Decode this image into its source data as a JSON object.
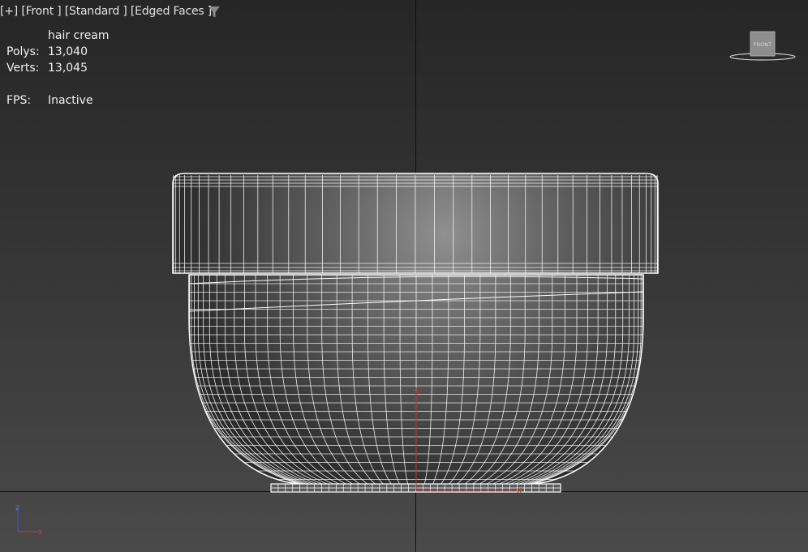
{
  "viewport": {
    "label_plus": "[+]",
    "label_view": "[Front ]",
    "label_shading": "[Standard ]",
    "label_edged": "[Edged Faces ]"
  },
  "stats": {
    "object_name": "hair cream",
    "polys_label": "Polys:",
    "polys_value": "13,040",
    "verts_label": "Verts:",
    "verts_value": "13,045",
    "fps_label": "FPS:",
    "fps_value": "Inactive"
  },
  "viewcube": {
    "face_label": "FRONT"
  },
  "gizmo": {
    "y_label": "y",
    "x_label": "x"
  },
  "triad": {
    "z_label": "z",
    "x_label": "x"
  },
  "colors": {
    "wireframe": "#ffffff",
    "axis_x": "#b03a3a",
    "axis_z": "#4050d0",
    "grid_line": "#101010"
  }
}
